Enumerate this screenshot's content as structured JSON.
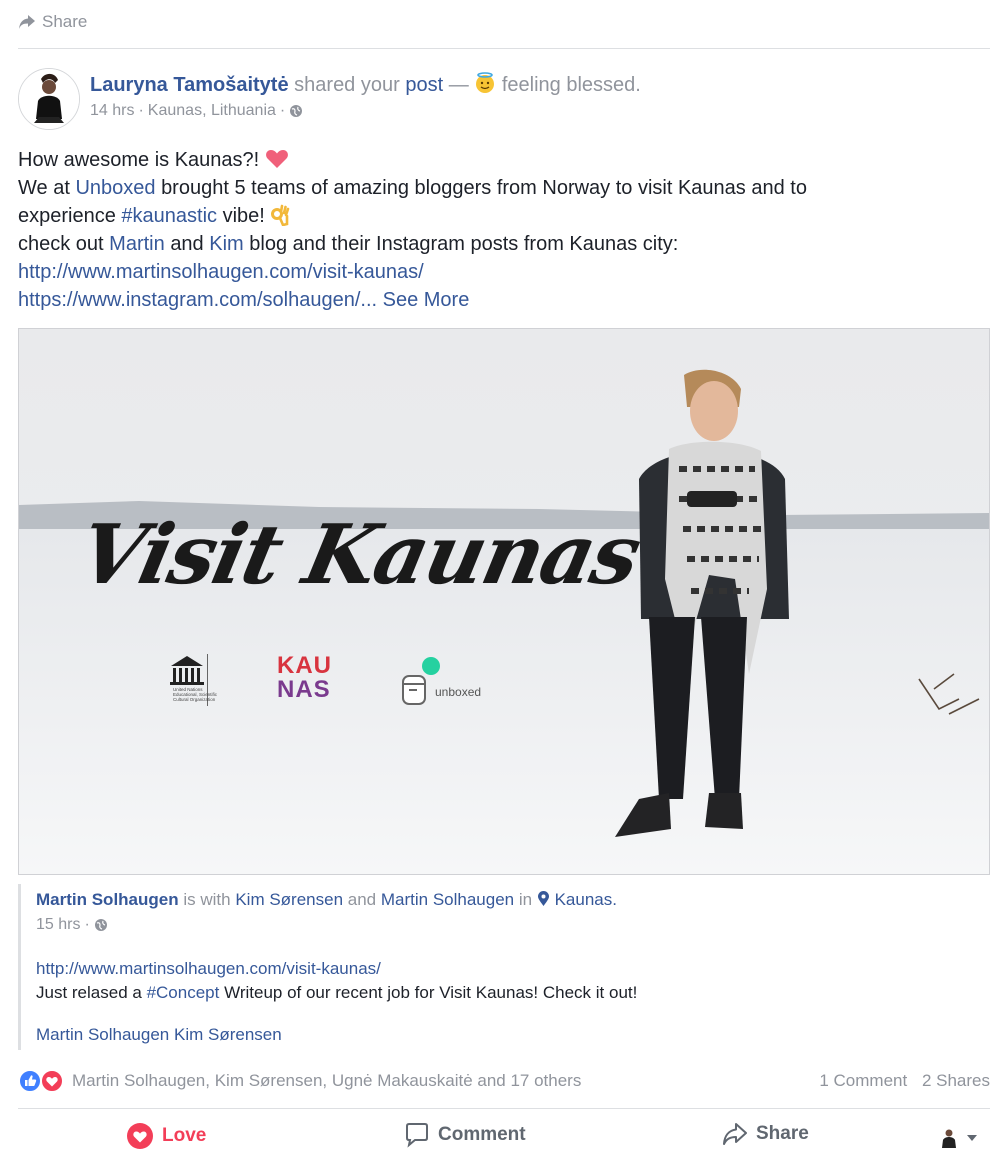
{
  "top_share": {
    "label": "Share",
    "icon": "share-arrow-icon"
  },
  "post": {
    "author": "Lauryna Tamošaitytė",
    "shared_text": "shared your",
    "post_word": "post",
    "dash": "—",
    "feeling": "feeling blessed.",
    "time": "14 hrs",
    "sep": "·",
    "location": "Kaunas, Lithuania",
    "body": {
      "line1": "How awesome is Kaunas?!",
      "line2_a": "We at",
      "line2_link": "Unboxed",
      "line2_b": "brought 5 teams of amazing bloggers from Norway to visit Kaunas and to",
      "line3_a": "experience",
      "line3_hashtag": "#kaunastic",
      "line3_b": "vibe!",
      "line4_a": "check out",
      "line4_link1": "Martin",
      "line4_and": "and",
      "line4_link2": "Kim",
      "line4_b": "blog and their Instagram posts from Kaunas city:",
      "url1": "http://www.martinsolhaugen.com/visit-kaunas/",
      "url2": "https://www.instagram.com/solhaugen/...",
      "see_more": "See More"
    }
  },
  "photo": {
    "title": "Visit Kaunas",
    "logo_unesco_caption": "United Nations Educational, Scientific and Cultural Organization",
    "logo_kaunas_top": "KAU",
    "logo_kaunas_bottom": "NAS",
    "logo_unboxed": "unboxed"
  },
  "shared_post": {
    "author": "Martin Solhaugen",
    "is_with": "is with",
    "tag1": "Kim Sørensen",
    "and": "and",
    "tag2": "Martin Solhaugen",
    "in": "in",
    "place": "Kaunas.",
    "time": "15 hrs",
    "sep": "·",
    "link": "http://www.martinsolhaugen.com/visit-kaunas/",
    "text_a": "Just relased a",
    "hashtag": "#Concept",
    "text_b": "Writeup of our recent job for Visit Kaunas! Check it out!",
    "tags_line": "Martin Solhaugen Kim Sørensen"
  },
  "reactions": {
    "names": "Martin Solhaugen, Kim Sørensen, Ugnė Makauskaitė and 17 others",
    "comments": "1 Comment",
    "shares": "2 Shares",
    "colors": {
      "like": "#4080ff",
      "love": "#f33e58"
    }
  },
  "actions": {
    "love": "Love",
    "comment": "Comment",
    "share": "Share"
  }
}
